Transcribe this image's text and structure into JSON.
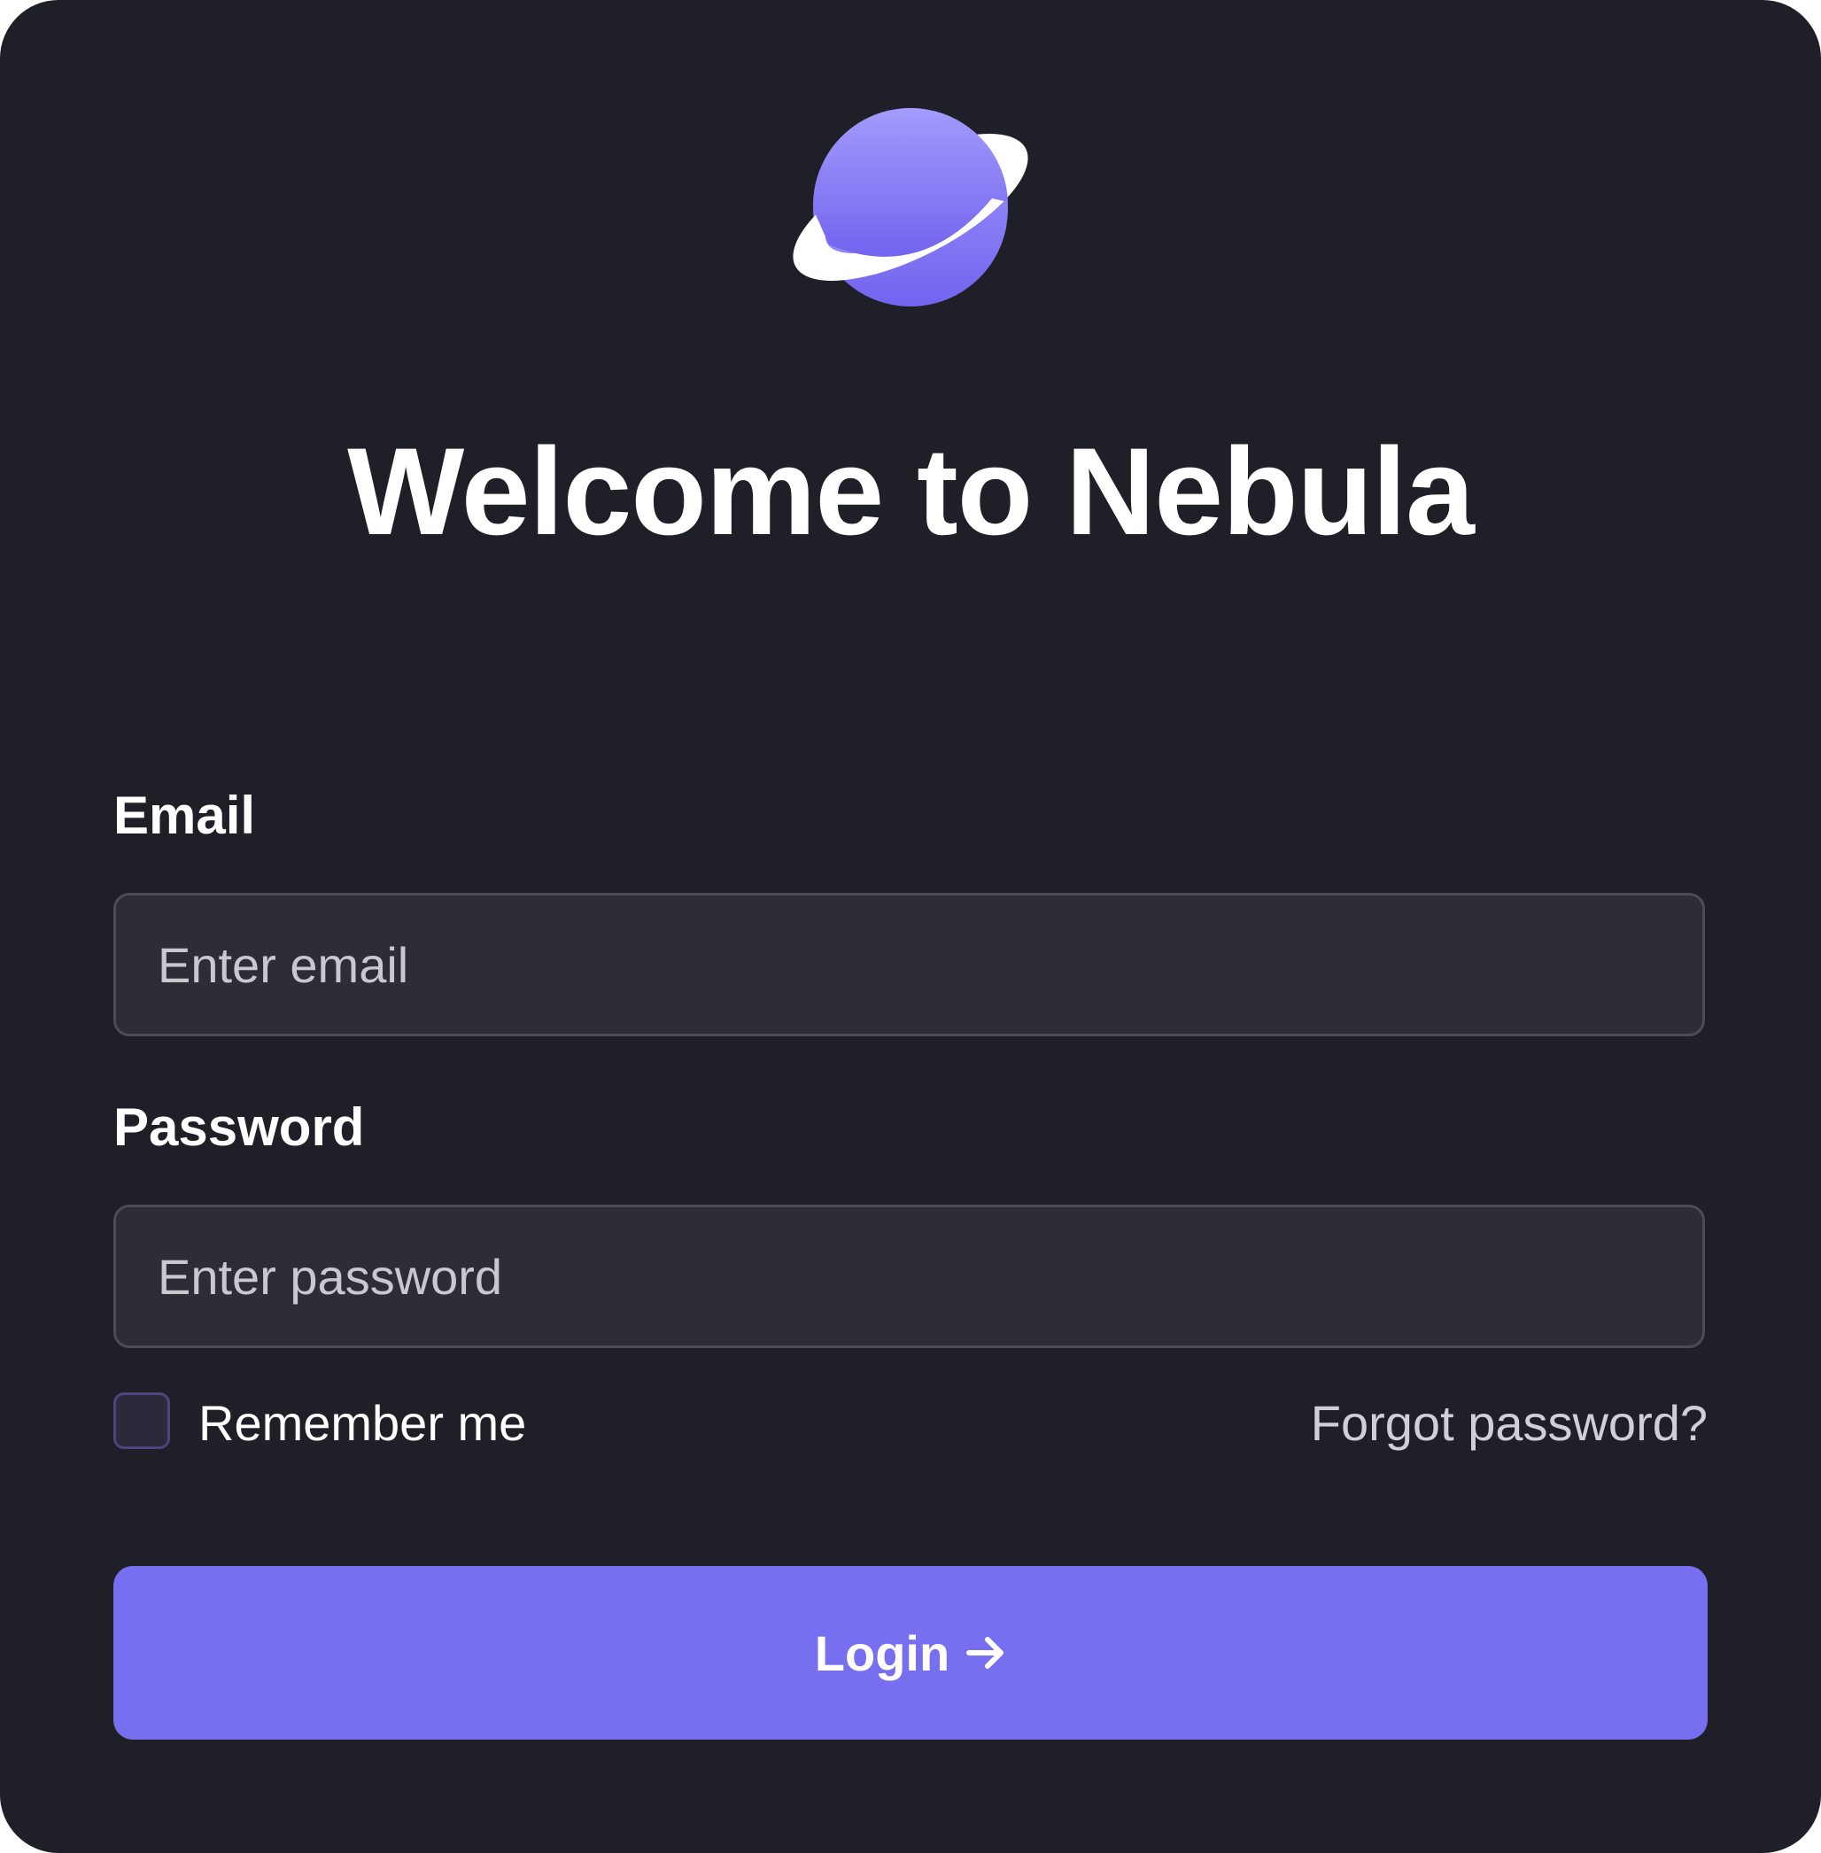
{
  "brand": {
    "logo_icon": "planet-ring-icon",
    "accent_color": "#776ef0",
    "background_color": "#1f2027"
  },
  "title": "Welcome to Nebula",
  "email": {
    "label": "Email",
    "placeholder": "Enter email",
    "value": ""
  },
  "password": {
    "label": "Password",
    "placeholder": "Enter password",
    "value": ""
  },
  "remember": {
    "label": "Remember me",
    "checked": false
  },
  "forgot_link": "Forgot password?",
  "login_button": {
    "label": "Login",
    "icon": "arrow-right-icon"
  }
}
